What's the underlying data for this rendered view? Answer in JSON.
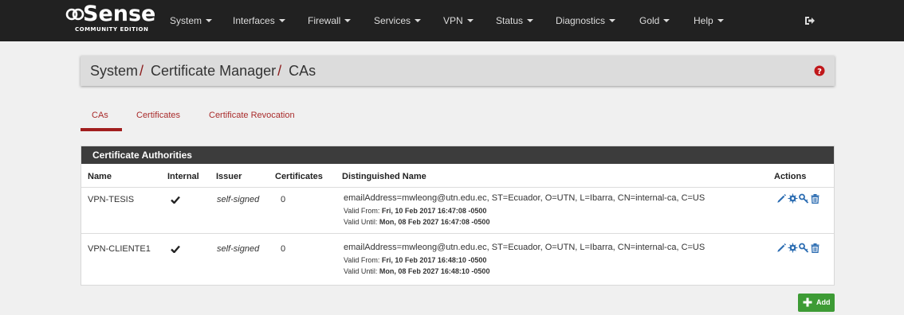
{
  "brand": {
    "name": "Sense",
    "edition": "COMMUNITY EDITION"
  },
  "nav": [
    {
      "label": "System"
    },
    {
      "label": "Interfaces"
    },
    {
      "label": "Firewall"
    },
    {
      "label": "Services"
    },
    {
      "label": "VPN"
    },
    {
      "label": "Status"
    },
    {
      "label": "Diagnostics"
    },
    {
      "label": "Gold"
    },
    {
      "label": "Help"
    }
  ],
  "breadcrumb": {
    "part1": "System",
    "part2": "Certificate Manager",
    "part3": "CAs",
    "separator": "/"
  },
  "tabs": [
    {
      "label": "CAs",
      "active": true
    },
    {
      "label": "Certificates",
      "active": false
    },
    {
      "label": "Certificate Revocation",
      "active": false
    }
  ],
  "panel": {
    "title": "Certificate Authorities",
    "columns": {
      "name": "Name",
      "internal": "Internal",
      "issuer": "Issuer",
      "certificates": "Certificates",
      "dn": "Distinguished Name",
      "actions": "Actions"
    },
    "rows": [
      {
        "name": "VPN-TESIS",
        "internal": true,
        "issuer": "self-signed",
        "certificates": "0",
        "dn": "emailAddress=mwleong@utn.edu.ec, ST=Ecuador, O=UTN, L=Ibarra, CN=internal-ca, C=US",
        "valid_from_label": "Valid From:",
        "valid_from": "Fri, 10 Feb 2017 16:47:08 -0500",
        "valid_until_label": "Valid Until:",
        "valid_until": "Mon, 08 Feb 2027 16:47:08 -0500"
      },
      {
        "name": "VPN-CLIENTE1",
        "internal": true,
        "issuer": "self-signed",
        "certificates": "0",
        "dn": "emailAddress=mwleong@utn.edu.ec, ST=Ecuador, O=UTN, L=Ibarra, CN=internal-ca, C=US",
        "valid_from_label": "Valid From:",
        "valid_from": "Fri, 10 Feb 2017 16:48:10 -0500",
        "valid_until_label": "Valid Until:",
        "valid_until": "Mon, 08 Feb 2027 16:48:10 -0500"
      }
    ]
  },
  "add_button": {
    "label": "Add"
  },
  "icons": {
    "logout": "logout-icon",
    "help": "help-circle-icon",
    "check": "check-icon",
    "edit": "pencil-icon",
    "export": "cog-icon",
    "key": "key-icon",
    "delete": "trash-icon",
    "add": "plus-icon"
  },
  "colors": {
    "topbar": "#212121",
    "accent": "#a11e1e",
    "panel_heading": "#3c3c3c",
    "action_blue": "#2c6db2",
    "add_green": "#3d9b35"
  }
}
